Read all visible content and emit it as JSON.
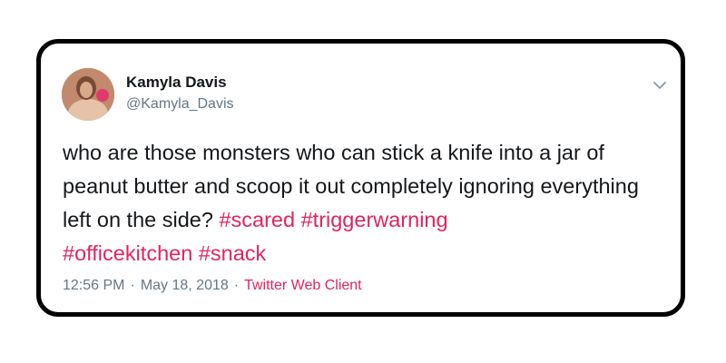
{
  "tweet": {
    "author_name": "Kamyla Davis",
    "author_handle": "@Kamyla_Davis",
    "text_segments": [
      "who are those monsters who can stick a knife into a jar of peanut butter and scoop it out completely ignoring everything left on the side? ",
      "#scared",
      " ",
      "#triggerwarning",
      " ",
      "#officekitchen",
      " ",
      "#snack"
    ],
    "time": "12:56 PM",
    "separator": "·",
    "date": "May 18, 2018",
    "source": "Twitter Web Client",
    "avatar_icon": "profile-photo",
    "menu_icon": "chevron-down-icon"
  },
  "colors": {
    "hashtag": "#e0245e",
    "text": "#14171a",
    "secondary": "#657786",
    "card_border": "#000000"
  }
}
